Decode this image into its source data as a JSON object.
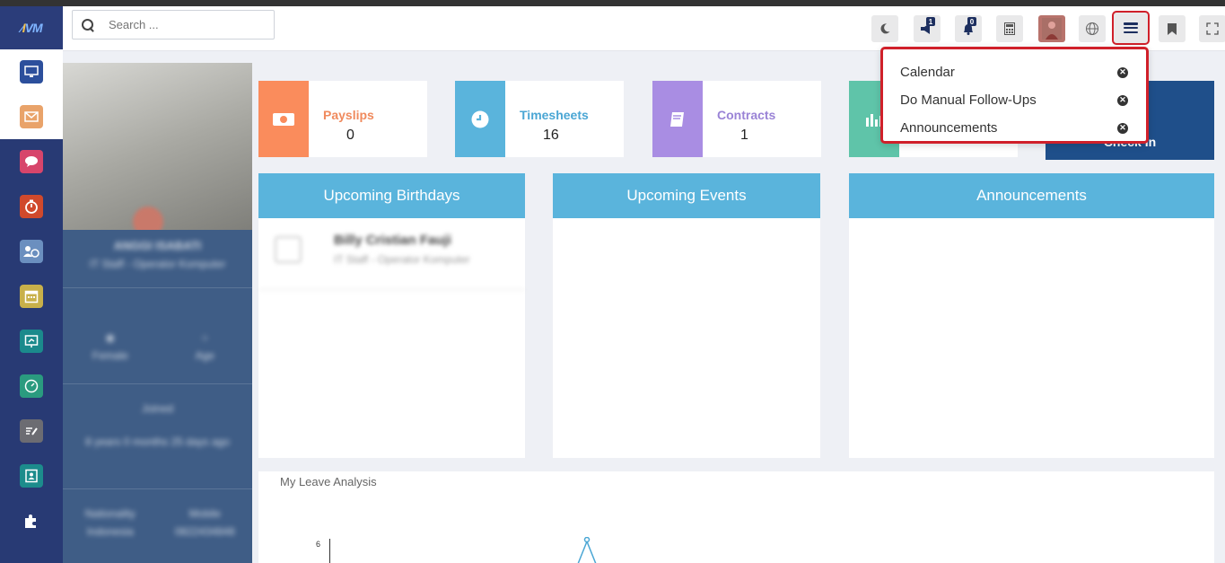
{
  "search": {
    "placeholder": "Search ..."
  },
  "header": {
    "chat_badge": "1",
    "notification_badge": "0"
  },
  "cards": [
    {
      "title": "Payslips",
      "value": "0",
      "color": "#fa8c5c",
      "title_color": "#f08a5d"
    },
    {
      "title": "Timesheets",
      "value": "16",
      "color": "#5ab4dc",
      "title_color": "#4aa6d4"
    },
    {
      "title": "Contracts",
      "value": "1",
      "color": "#a98de3",
      "title_color": "#9a83d6"
    },
    {
      "title": "",
      "value": "",
      "color": "#5fc4a9",
      "title_color": "#5fc4a9"
    }
  ],
  "checkin": {
    "label": "Check In"
  },
  "widgets": [
    {
      "title": "Upcoming Birthdays"
    },
    {
      "title": "Upcoming Events"
    },
    {
      "title": "Announcements"
    }
  ],
  "birthday": {
    "name": "Billy Cristian Fauji",
    "role": "IT Staff - Operator Komputer"
  },
  "profile": {
    "name": "ANGGI ISABATI",
    "role": "IT Staff - Operator Komputer",
    "gender": "Female",
    "age": "Age",
    "joined": "Joined",
    "tenure": "8 years 0 months 25 days ago",
    "nationality_label": "Nationality",
    "nationality": "Indonesia",
    "mobile_label": "Mobile",
    "mobile": "0822434848"
  },
  "analysis": {
    "title": "My Leave Analysis",
    "y_tick": "6"
  },
  "dropdown": {
    "items": [
      {
        "label": "Calendar"
      },
      {
        "label": "Do Manual Follow-Ups"
      },
      {
        "label": "Announcements"
      }
    ]
  },
  "colors": {
    "sidebar": "#283a74",
    "accent_red": "#d0202a",
    "widget_head": "#5ab4dc",
    "checkin": "#1f4f8a"
  }
}
